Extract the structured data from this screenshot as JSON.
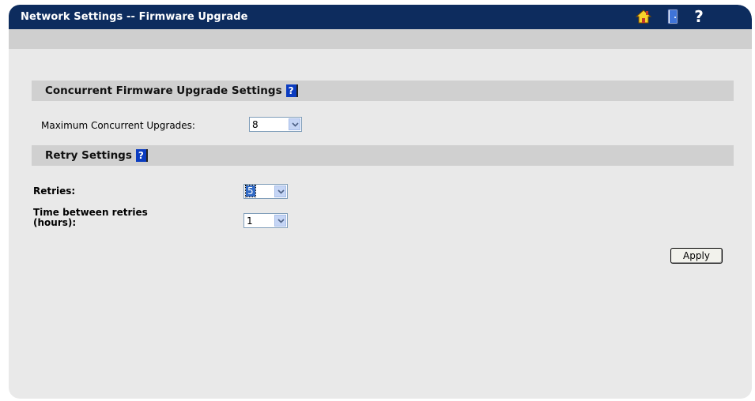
{
  "header": {
    "title": "Network Settings -- Firmware Upgrade",
    "icons": [
      "home-icon",
      "door-icon",
      "help-icon"
    ],
    "help_glyph": "?"
  },
  "sections": [
    {
      "title": "Concurrent Firmware Upgrade Settings",
      "help_glyph": "?",
      "fields": [
        {
          "label": "Maximum Concurrent Upgrades:",
          "value": "8"
        }
      ]
    },
    {
      "title": "Retry Settings",
      "help_glyph": "?",
      "fields": [
        {
          "label": "Retries:",
          "value": "5"
        },
        {
          "label_line1": "Time between retries",
          "label_line2": "(hours):",
          "value": "1"
        }
      ]
    }
  ],
  "apply_label": "Apply",
  "colors": {
    "titlebar": "#0d2c5e",
    "panel": "#e9e9e9",
    "section_bar": "#d0d0d0",
    "help_box": "#0b3cc0",
    "selection": "#316ac5"
  }
}
